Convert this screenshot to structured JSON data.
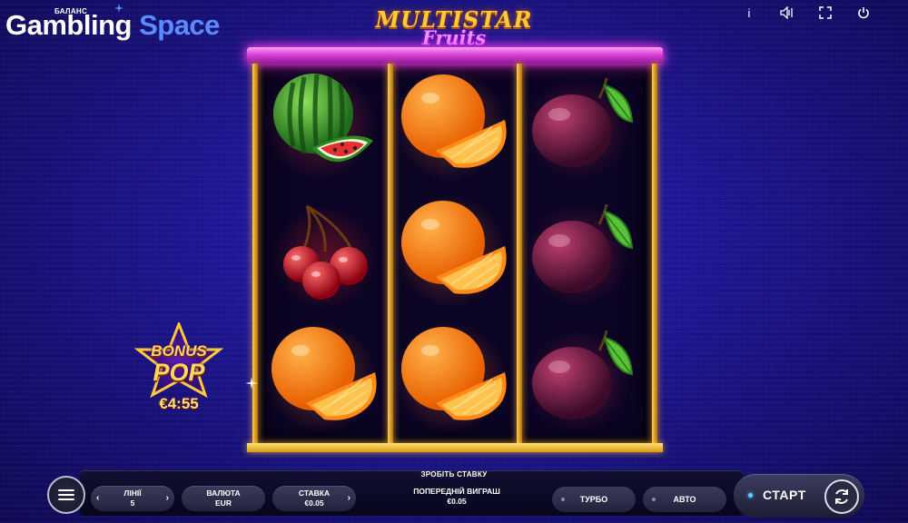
{
  "brand": {
    "balance_label": "БАЛАНС",
    "name_part1": "Gambling",
    "name_part2": "Space"
  },
  "game_logo": {
    "title": "MULTISTAR",
    "subtitle": "Fruits"
  },
  "top_icons": [
    "info-icon",
    "sound-icon",
    "fullscreen-icon",
    "power-icon"
  ],
  "top_icon_glyphs": [
    "i",
    "🔈",
    "⛶",
    "⏻"
  ],
  "reels": [
    [
      "watermelon",
      "cherries",
      "orange"
    ],
    [
      "orange",
      "orange",
      "orange"
    ],
    [
      "plum",
      "plum",
      "plum"
    ]
  ],
  "bonus_pop": {
    "line1": "BONUS",
    "line2": "POP",
    "amount": "€4:55"
  },
  "bottom_bar": {
    "make_bet": "ЗРОБІТЬ СТАВКУ",
    "lines_label": "ЛІНІЇ",
    "lines_value": "5",
    "currency_label": "ВАЛЮТА",
    "currency_value": "EUR",
    "bet_label": "СТАВКА",
    "bet_value": "€0.05",
    "prev_win_label": "ПОПЕРЕДНІЙ ВИГРАШ",
    "prev_win_value": "€0.05",
    "turbo_label": "ТУРБО",
    "auto_label": "АВТО",
    "start_label": "СТАРТ"
  },
  "colors": {
    "background": "#1e1693",
    "frame_top": "#d43ad0",
    "frame_gold": "#ffcf57",
    "brand_accent": "#5b8cff"
  }
}
